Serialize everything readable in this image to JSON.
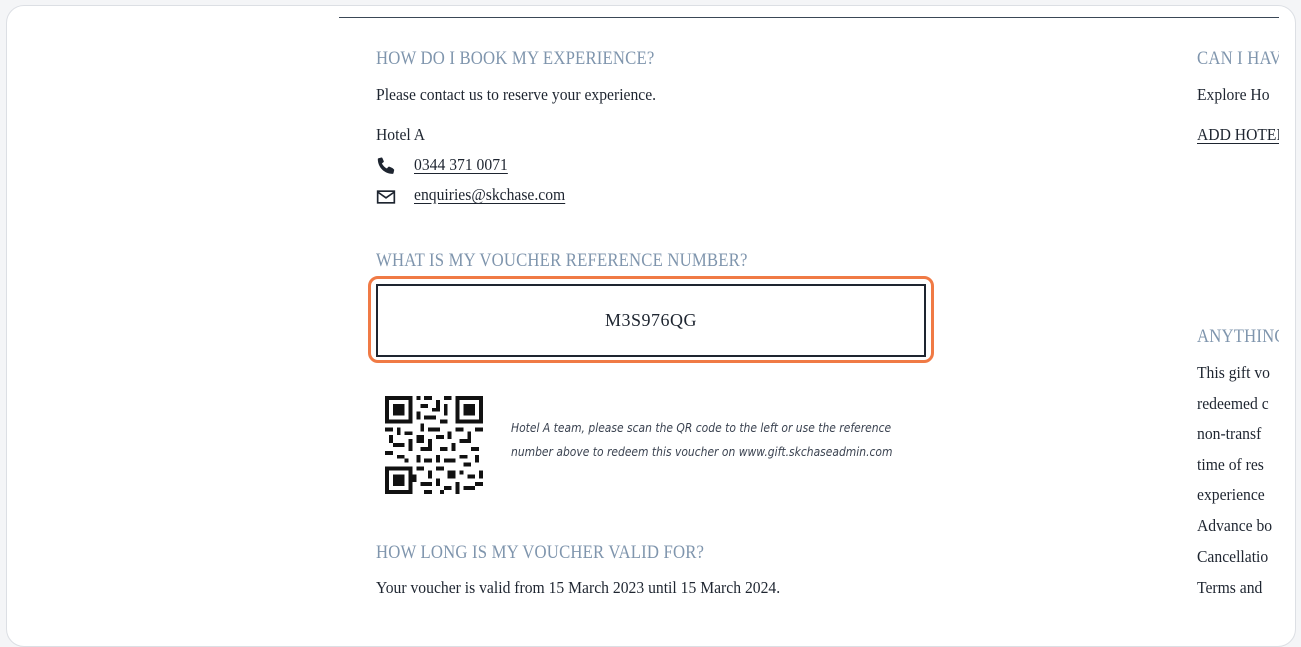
{
  "left": {
    "booking": {
      "heading": "HOW DO I BOOK MY EXPERIENCE?",
      "intro": "Please contact us to reserve your experience.",
      "hotel_name": "Hotel A",
      "phone": "0344 371 0071",
      "email": "enquiries@skchase.com"
    },
    "reference": {
      "heading": "WHAT IS MY VOUCHER REFERENCE NUMBER?",
      "code": "M3S976QG",
      "qr_note_line1": "Hotel A team, please scan the QR code to the left or use the reference",
      "qr_note_line2": "number above to redeem this voucher on www.gift.skchaseadmin.com"
    },
    "validity": {
      "heading": "HOW LONG IS MY VOUCHER VALID FOR?",
      "text": "Your voucher is valid from 15 March 2023 until 15 March 2024."
    }
  },
  "right": {
    "heading1": "CAN I HAV",
    "explore": "Explore Ho",
    "add_link": "ADD HOTEL",
    "heading2": "ANYTHINC",
    "lines": [
      "This gift vo",
      "redeemed c",
      "non-transf",
      "time of res",
      "experience",
      "Advance bo",
      "Cancellatio",
      "Terms and"
    ]
  },
  "icons": {
    "phone": "phone-icon",
    "email": "envelope-icon",
    "qr": "qr-code"
  },
  "colors": {
    "heading": "#7f95ad",
    "text": "#1e2530",
    "highlight": "#f07a45"
  }
}
